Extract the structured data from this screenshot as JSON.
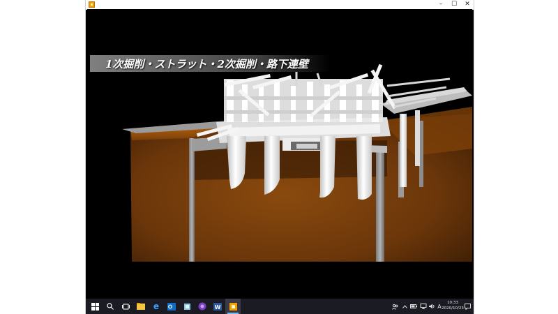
{
  "window": {
    "minimize_glyph": "–",
    "maximize_glyph": "☐",
    "close_glyph": "✕"
  },
  "video": {
    "caption": "1次掘削・ストラット・2次掘削・路下連壁"
  },
  "taskbar": {
    "icons": [
      "windows-start-icon",
      "search-icon",
      "task-view-icon",
      "file-explorer-icon",
      "edge-icon",
      "outlook-icon",
      "app-icon",
      "media-app-icon",
      "word-icon",
      "video-player-icon"
    ],
    "input_indicator": "A",
    "clock": {
      "time": "10:33",
      "date": "2020/10/23"
    }
  }
}
